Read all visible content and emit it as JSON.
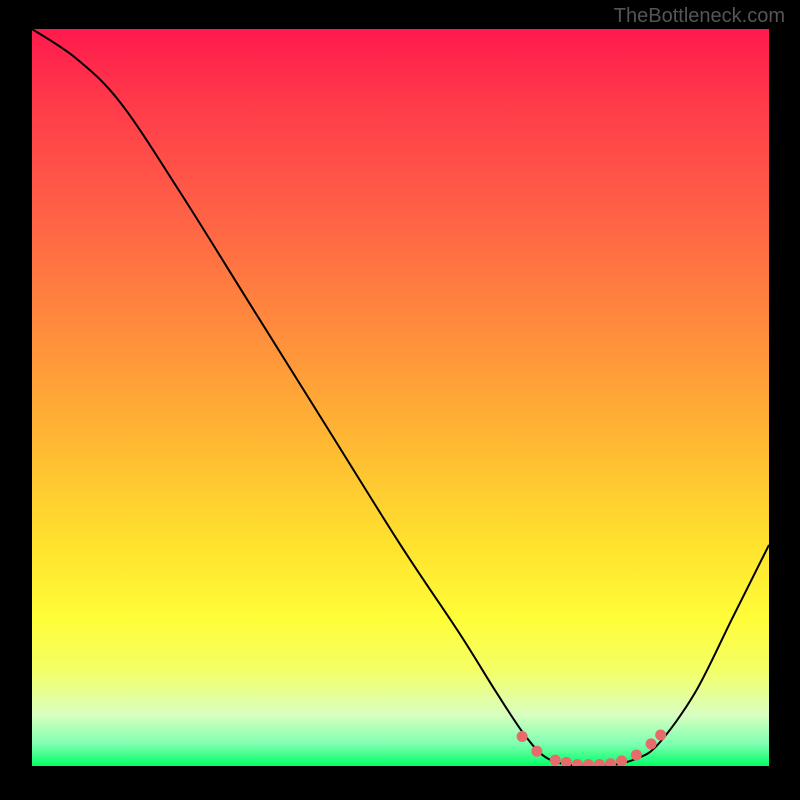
{
  "watermark": "TheBottleneck.com",
  "chart_data": {
    "type": "line",
    "title": "",
    "xlabel": "",
    "ylabel": "",
    "xlim": [
      0,
      100
    ],
    "ylim": [
      0,
      100
    ],
    "curve": {
      "name": "bottleneck-curve",
      "points": [
        {
          "x": 0,
          "y": 100
        },
        {
          "x": 6,
          "y": 96
        },
        {
          "x": 12,
          "y": 90
        },
        {
          "x": 20,
          "y": 78
        },
        {
          "x": 30,
          "y": 62
        },
        {
          "x": 40,
          "y": 46
        },
        {
          "x": 50,
          "y": 30
        },
        {
          "x": 58,
          "y": 18
        },
        {
          "x": 63,
          "y": 10
        },
        {
          "x": 67,
          "y": 4
        },
        {
          "x": 70,
          "y": 1
        },
        {
          "x": 74,
          "y": 0
        },
        {
          "x": 78,
          "y": 0
        },
        {
          "x": 82,
          "y": 1
        },
        {
          "x": 85,
          "y": 3
        },
        {
          "x": 90,
          "y": 10
        },
        {
          "x": 95,
          "y": 20
        },
        {
          "x": 100,
          "y": 30
        }
      ]
    },
    "markers": {
      "name": "bottom-markers",
      "color": "#e76b6b",
      "points": [
        {
          "x": 66.5,
          "y": 4
        },
        {
          "x": 68.5,
          "y": 2
        },
        {
          "x": 71,
          "y": 0.8
        },
        {
          "x": 72.5,
          "y": 0.5
        },
        {
          "x": 74,
          "y": 0.2
        },
        {
          "x": 75.5,
          "y": 0.2
        },
        {
          "x": 77,
          "y": 0.2
        },
        {
          "x": 78.5,
          "y": 0.3
        },
        {
          "x": 80,
          "y": 0.7
        },
        {
          "x": 82,
          "y": 1.5
        },
        {
          "x": 84,
          "y": 3
        },
        {
          "x": 85.3,
          "y": 4.2
        }
      ]
    }
  }
}
